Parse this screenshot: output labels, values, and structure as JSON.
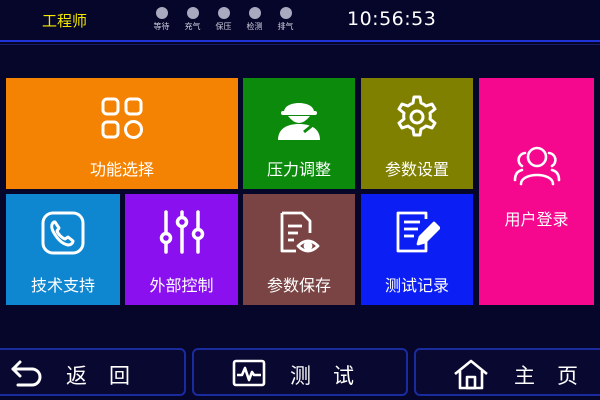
{
  "header": {
    "user_role": "工程师",
    "status": [
      {
        "label": "等待",
        "icon": "status-dot"
      },
      {
        "label": "充气",
        "icon": "status-dot"
      },
      {
        "label": "保压",
        "icon": "status-dot"
      },
      {
        "label": "检测",
        "icon": "status-dot"
      },
      {
        "label": "排气",
        "icon": "status-dot"
      }
    ],
    "time": "10:56:53"
  },
  "tiles": {
    "function_select": {
      "label": "功能选择",
      "icon": "grid-icon",
      "color": "#f58303"
    },
    "pressure_adjust": {
      "label": "压力调整",
      "icon": "worker-icon",
      "color": "#0b8a0b"
    },
    "param_settings": {
      "label": "参数设置",
      "icon": "gear-icon",
      "color": "#808000"
    },
    "user_login": {
      "label": "用户登录",
      "icon": "users-icon",
      "color": "#f5078e"
    },
    "tech_support": {
      "label": "技术支持",
      "icon": "phone-icon",
      "color": "#0e86d0"
    },
    "external_control": {
      "label": "外部控制",
      "icon": "sliders-icon",
      "color": "#8a10f0"
    },
    "param_save": {
      "label": "参数保存",
      "icon": "document-eye-icon",
      "color": "#7a4444"
    },
    "test_record": {
      "label": "测试记录",
      "icon": "note-pen-icon",
      "color": "#0b1ff5"
    }
  },
  "nav": {
    "back": {
      "label": "返回",
      "icon": "back-arrow-icon"
    },
    "test": {
      "label": "测试",
      "icon": "waveform-icon"
    },
    "home": {
      "label": "主页",
      "icon": "home-icon"
    }
  }
}
